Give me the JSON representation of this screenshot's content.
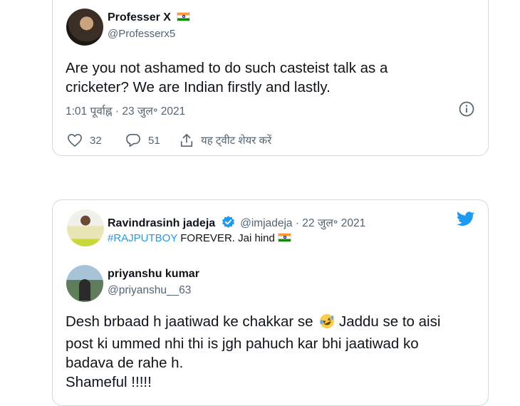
{
  "tweet1": {
    "name": "Professer X",
    "handle": "@Professerx5",
    "text_line1": "Are you not ashamed to do such casteist talk as a",
    "text_line2": "cricketer?  We are Indian firstly and lastly.",
    "timestamp": "1:01 पूर्वाह्न · 23 जुल॰ 2021",
    "likes": "32",
    "replies": "51",
    "share_label": "यह ट्वीट शेयर करें"
  },
  "tweet2": {
    "name": "Ravindrasinh jadeja",
    "handle_date": "@imjadeja · 22 जुल॰ 2021",
    "hashtag": "#RAJPUTBOY",
    "text_rest": " FOREVER. Jai hind",
    "quoted": {
      "name": "priyanshu kumar",
      "handle": "@priyanshu__63",
      "line1": "Desh brbaad h jaatiwad ke chakkar se",
      "line1_after": " Jaddu se to aisi",
      "line2": "post ki ummed nhi thi is jgh pahuch kar bhi jaatiwad ko",
      "line3": "badava de rahe h.",
      "line4": "Shameful !!!!!"
    }
  },
  "colors": {
    "accent": "#1d9bf0",
    "secondary_text": "#536471",
    "border": "#cfd9de"
  },
  "icons": [
    "heart-icon",
    "reply-icon",
    "share-icon",
    "info-icon",
    "verified-icon",
    "twitter-logo-icon",
    "emoji-rofl-icon"
  ]
}
